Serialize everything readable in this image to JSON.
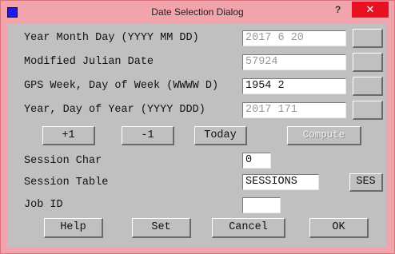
{
  "window": {
    "title": "Date Selection Dialog",
    "help_glyph": "?",
    "close_glyph": "✕"
  },
  "rows": [
    {
      "label": "Year Month Day (YYYY MM DD)",
      "value": "2017 6 20"
    },
    {
      "label": "Modified Julian Date",
      "value": "57924"
    },
    {
      "label": "GPS Week, Day of Week (WWWW D)",
      "value": "1954 2"
    },
    {
      "label": "Year, Day of Year (YYYY DDD)",
      "value": "2017 171"
    }
  ],
  "actions": {
    "plus": "+1",
    "minus": "-1",
    "today": "Today",
    "compute": "Compute"
  },
  "session_char": {
    "label": "Session Char",
    "value": "0"
  },
  "session_table": {
    "label": "Session Table",
    "value": "SESSIONS",
    "button": "SES"
  },
  "job_id": {
    "label": "Job ID",
    "value": ""
  },
  "footer": {
    "help": "Help",
    "set": "Set",
    "cancel": "Cancel",
    "ok": "OK"
  },
  "icons": {
    "app": "app-icon",
    "help": "help-icon",
    "close": "close-icon"
  },
  "colors": {
    "titlebar": "#f1a4ac",
    "close": "#e81123",
    "dialog_bg": "#c0c0c0"
  }
}
